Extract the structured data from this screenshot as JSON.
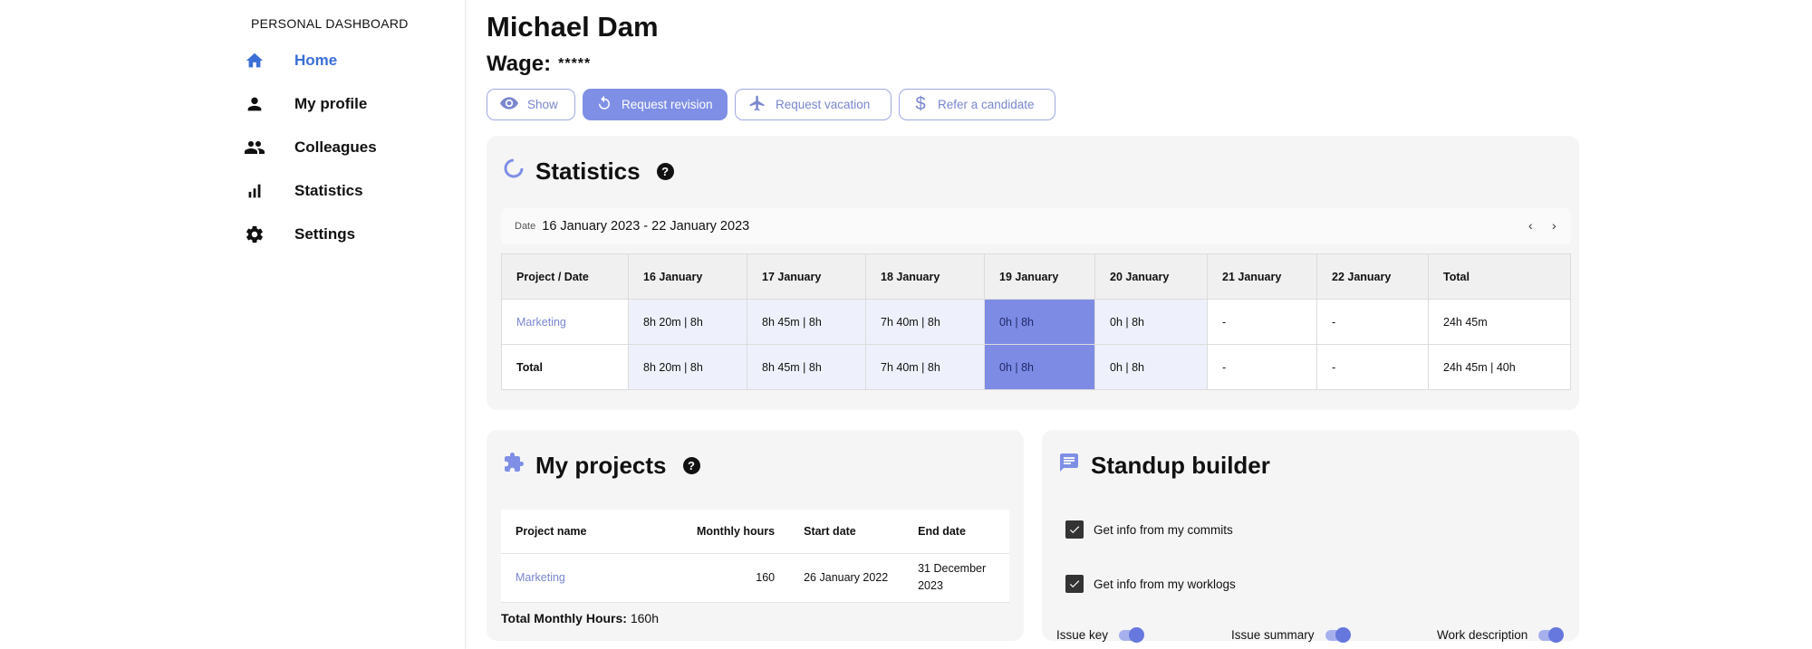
{
  "sidebar": {
    "title": "PERSONAL DASHBOARD",
    "items": [
      {
        "label": "Home",
        "icon": "home-icon"
      },
      {
        "label": "My profile",
        "icon": "person-icon"
      },
      {
        "label": "Colleagues",
        "icon": "group-icon"
      },
      {
        "label": "Statistics",
        "icon": "bar-chart-icon"
      },
      {
        "label": "Settings",
        "icon": "gear-icon"
      }
    ]
  },
  "header": {
    "name": "Michael Dam",
    "wage_label": "Wage:",
    "wage_value": "*****"
  },
  "actions": {
    "show": "Show",
    "request_revision": "Request revision",
    "request_vacation": "Request vacation",
    "refer_candidate": "Refer a candidate"
  },
  "statistics": {
    "title": "Statistics",
    "help": "?",
    "date_label": "Date",
    "date_range": "16 January 2023 - 22 January 2023",
    "columns": [
      "Project / Date",
      "16 January",
      "17 January",
      "18 January",
      "19 January",
      "20 January",
      "21 January",
      "22 January",
      "Total"
    ],
    "rows": [
      {
        "project": "Marketing",
        "cells": [
          "8h 20m | 8h",
          "8h 45m | 8h",
          "7h 40m | 8h",
          "0h | 8h",
          "0h | 8h",
          "-",
          "-",
          "24h 45m"
        ]
      },
      {
        "project": "Total",
        "cells": [
          "8h 20m | 8h",
          "8h 45m | 8h",
          "7h 40m | 8h",
          "0h | 8h",
          "0h | 8h",
          "-",
          "-",
          "24h 45m | 40h"
        ]
      }
    ]
  },
  "projects": {
    "title": "My projects",
    "help": "?",
    "columns": [
      "Project name",
      "Monthly hours",
      "Start date",
      "End date"
    ],
    "rows": [
      {
        "name": "Marketing",
        "hours": "160",
        "start": "26 January 2022",
        "end_line1": "31 December",
        "end_line2": "2023"
      }
    ],
    "total_label": "Total Monthly Hours:",
    "total_value": "160h"
  },
  "standup": {
    "title": "Standup builder",
    "checkboxes": [
      "Get info from my commits",
      "Get info from my worklogs"
    ],
    "toggles": [
      "Issue key",
      "Issue summary",
      "Work description"
    ]
  },
  "colors": {
    "accent": "#7f8fe6",
    "nav_active": "#3b6fd6",
    "highlight_cell": "#7d8be4"
  }
}
